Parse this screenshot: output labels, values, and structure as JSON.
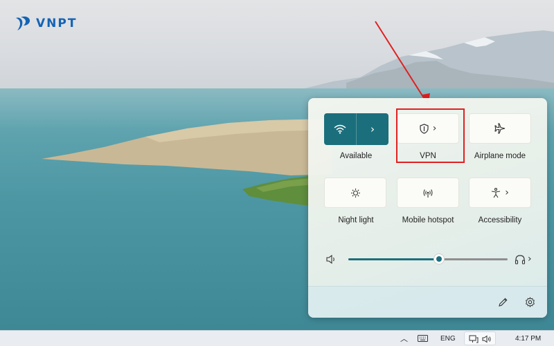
{
  "logo": {
    "text": "VNPT",
    "color": "#1463b5"
  },
  "quick_settings": {
    "accent_color": "#1b6f7c",
    "tiles": [
      {
        "id": "wifi",
        "label": "Available",
        "icon": "wifi-icon",
        "active": true,
        "has_chevron": true
      },
      {
        "id": "vpn",
        "label": "VPN",
        "icon": "shield-icon",
        "active": false,
        "has_chevron": true
      },
      {
        "id": "airplane",
        "label": "Airplane mode",
        "icon": "airplane-icon",
        "active": false,
        "has_chevron": false
      },
      {
        "id": "night-light",
        "label": "Night light",
        "icon": "sun-icon",
        "active": false,
        "has_chevron": false
      },
      {
        "id": "mobile-hotspot",
        "label": "Mobile hotspot",
        "icon": "hotspot-icon",
        "active": false,
        "has_chevron": false
      },
      {
        "id": "accessibility",
        "label": "Accessibility",
        "icon": "accessibility-icon",
        "active": false,
        "has_chevron": true
      }
    ],
    "volume": {
      "level": 0.57,
      "speaker_icon": "speaker-icon",
      "output_icon": "headphones-icon"
    },
    "footer": {
      "edit_icon": "pencil-icon",
      "settings_icon": "gear-icon"
    }
  },
  "annotation": {
    "color": "#e02020",
    "target": "vpn"
  },
  "taskbar": {
    "language": "ENG",
    "time": "4:17 PM",
    "tray_icons": [
      "chevron-up-icon",
      "keyboard-icon",
      "network-icon",
      "volume-icon"
    ]
  }
}
